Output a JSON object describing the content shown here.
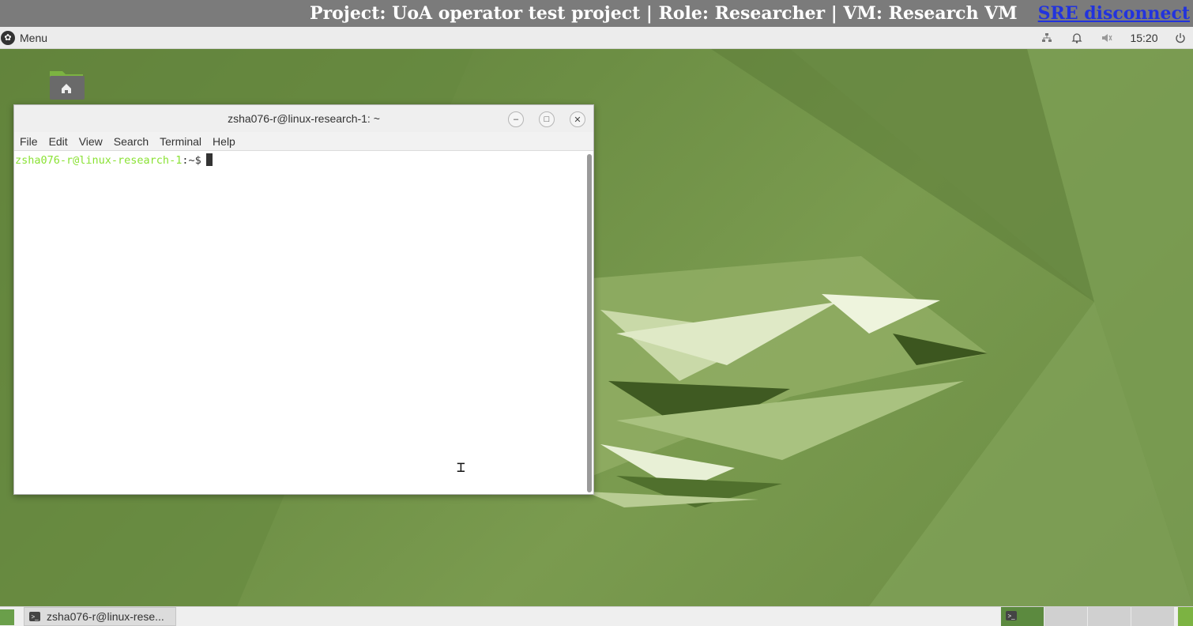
{
  "sre_banner": {
    "info": "Project: UoA operator test project | Role: Researcher | VM: Research VM",
    "disconnect_label": "SRE disconnect"
  },
  "top_panel": {
    "menu_label": "Menu",
    "clock": "15:20",
    "tray_icons": [
      "network-disconnected-icon",
      "notifications-bell-icon",
      "volume-muted-icon",
      "power-icon"
    ]
  },
  "terminal": {
    "title": "zsha076-r@linux-research-1: ~",
    "menus": [
      "File",
      "Edit",
      "View",
      "Search",
      "Terminal",
      "Help"
    ],
    "prompt_user": "zsha076-r@linux-research-1",
    "prompt_suffix": ":~$"
  },
  "taskbar": {
    "task_label": "zsha076-r@linux-rese..."
  },
  "colors": {
    "banner_bg": "#7b7b7b",
    "link": "#2233dd",
    "prompt_green": "#8ae234",
    "wallpaper_green": "#6f8f47"
  }
}
